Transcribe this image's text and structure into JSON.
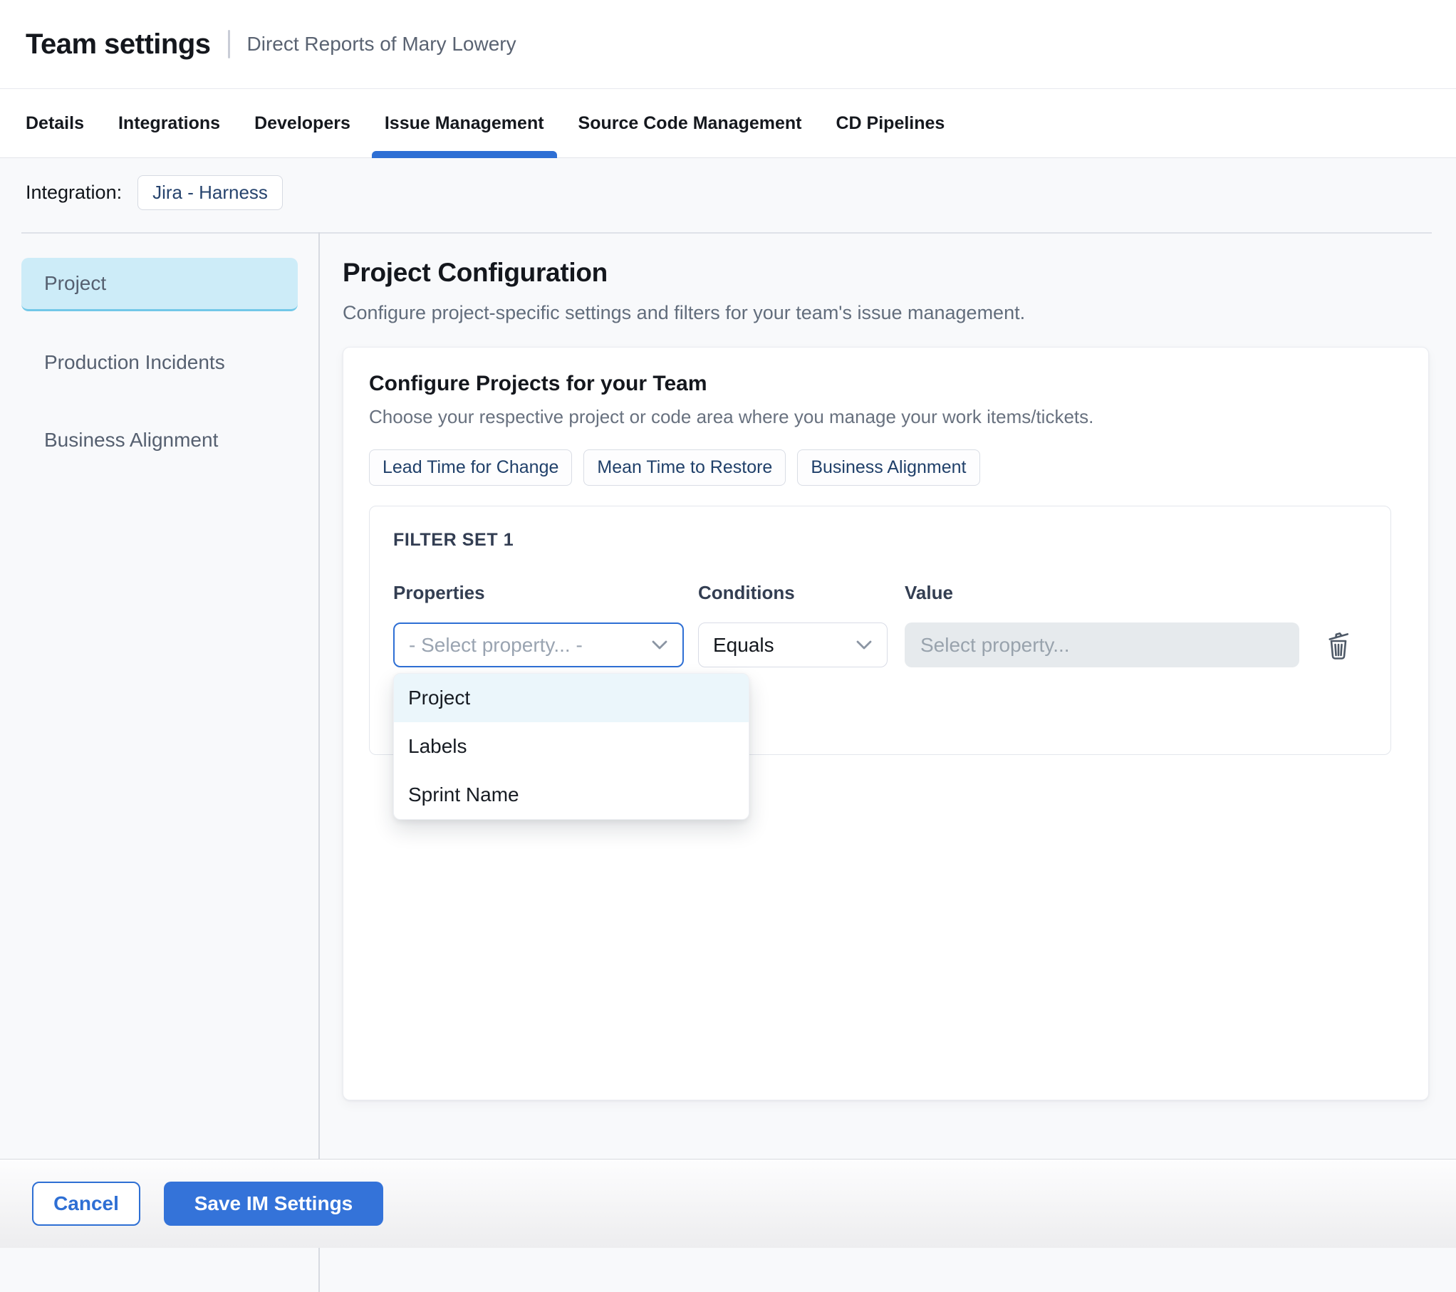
{
  "header": {
    "title": "Team settings",
    "subtitle": "Direct Reports of Mary Lowery"
  },
  "tabs": {
    "items": [
      "Details",
      "Integrations",
      "Developers",
      "Issue Management",
      "Source Code Management",
      "CD Pipelines"
    ],
    "active": "Issue Management"
  },
  "integration": {
    "label": "Integration:",
    "chip": "Jira - Harness"
  },
  "sidebar": {
    "items": [
      {
        "label": "Project",
        "selected": true
      },
      {
        "label": "Production Incidents",
        "selected": false
      },
      {
        "label": "Business Alignment",
        "selected": false
      }
    ]
  },
  "main": {
    "heading": "Project Configuration",
    "description": "Configure project-specific settings and filters for your team's issue management."
  },
  "card": {
    "title": "Configure Projects for your Team",
    "subtitle": "Choose your respective project or code area where you manage your work items/tickets.",
    "chips": [
      "Lead Time for Change",
      "Mean Time to Restore",
      "Business Alignment"
    ]
  },
  "filter_set": {
    "title": "FILTER SET 1",
    "columns": {
      "properties": "Properties",
      "conditions": "Conditions",
      "value": "Value"
    },
    "property_select": {
      "value": "- Select property... -"
    },
    "condition_select": {
      "value": "Equals"
    },
    "value_input": {
      "placeholder": "Select property...",
      "value": ""
    },
    "dropdown": {
      "options": [
        {
          "label": "Project",
          "highlighted": true
        },
        {
          "label": "Labels",
          "highlighted": false
        },
        {
          "label": "Sprint Name",
          "highlighted": false
        }
      ]
    },
    "icons": {
      "delete": "trash-icon",
      "select_caret": "chevron-down-icon"
    }
  },
  "footer": {
    "cancel_label": "Cancel",
    "save_label": "Save IM Settings"
  },
  "colors": {
    "accent_blue": "#2e6fd4",
    "save_button_bg": "#3473d9",
    "selected_item_bg": "#cdecf8",
    "selected_item_border": "#72c8e8",
    "dropdown_highlight": "#ebf6fb"
  }
}
